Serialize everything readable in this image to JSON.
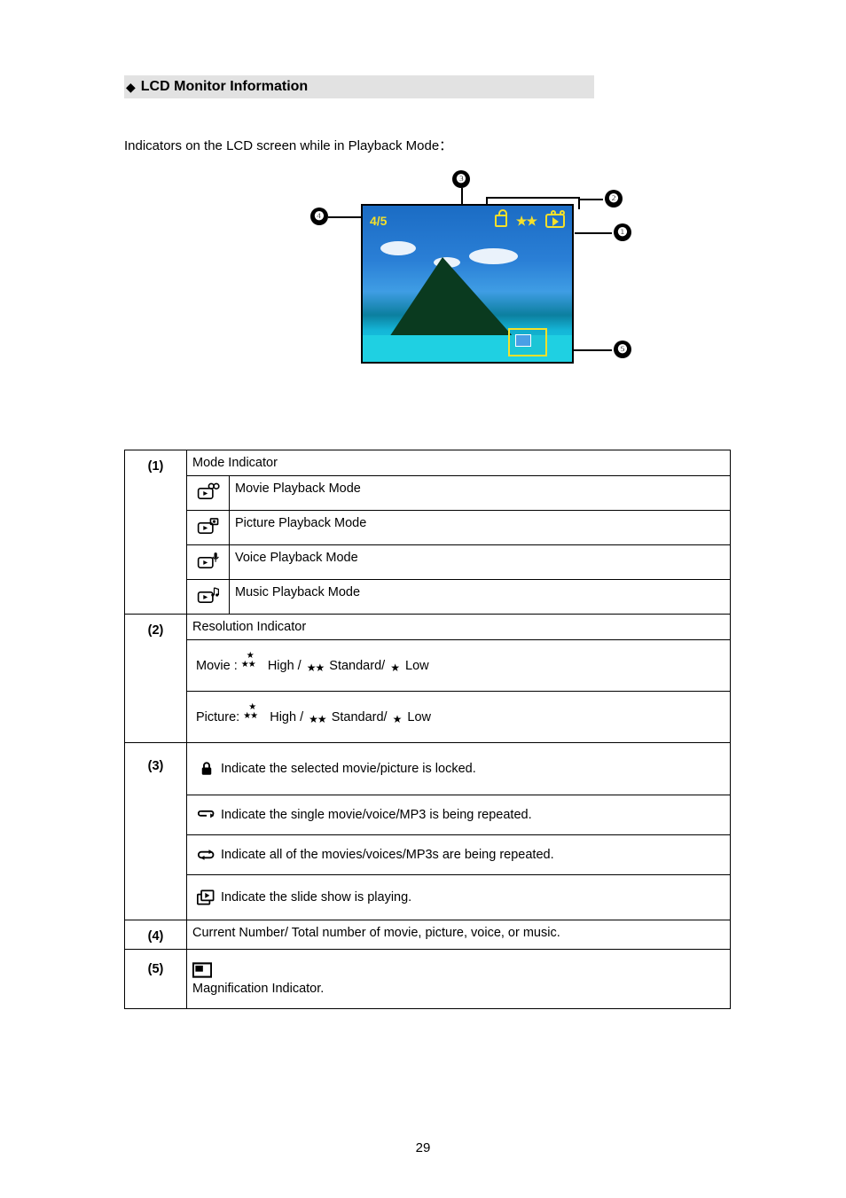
{
  "heading": "LCD Monitor Information",
  "intro": "Indicators on the LCD screen while in Playback Mode：",
  "lcd": {
    "counter": "4/5",
    "resolution_stars": "★★"
  },
  "callouts": {
    "c1": "❶",
    "c2": "❷",
    "c3": "❸",
    "c4": "❹",
    "c5": "❺"
  },
  "table": {
    "row1": {
      "num": "(1)",
      "header": "Mode Indicator",
      "modes": {
        "movie": "Movie Playback Mode",
        "picture": "Picture Playback Mode",
        "voice": "Voice Playback Mode",
        "music": "Music Playback Mode"
      }
    },
    "row2": {
      "num": "(2)",
      "header": "Resolution Indicator",
      "movie_prefix": "Movie :",
      "picture_prefix": "Picture: ",
      "high": "High / ",
      "standard": "Standard/ ",
      "low": " Low"
    },
    "row3": {
      "num": "(3)",
      "locked": " Indicate the selected movie/picture is locked.",
      "repeat_one": "Indicate the single movie/voice/MP3 is being repeated.",
      "repeat_all": "Indicate all of the movies/voices/MP3s are being repeated.",
      "slideshow": " Indicate the slide show is playing."
    },
    "row4": {
      "num": "(4)",
      "text": "Current Number/ Total number of movie, picture, voice, or music."
    },
    "row5": {
      "num": "(5)",
      "text": " Magnification Indicator."
    }
  },
  "page_number": "29"
}
